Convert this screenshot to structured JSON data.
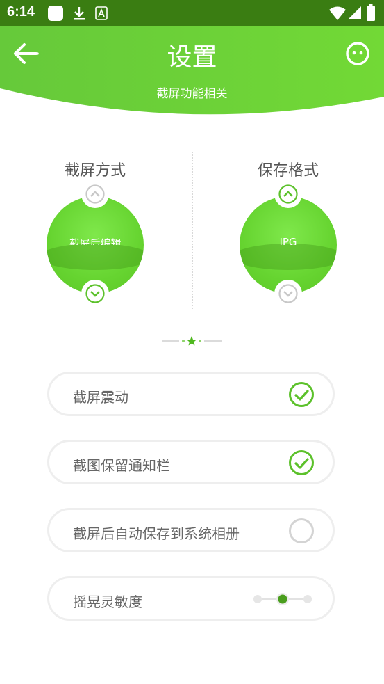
{
  "status_bar": {
    "time": "6:14"
  },
  "header": {
    "title": "设置",
    "subtitle": "截屏功能相关"
  },
  "pickers": [
    {
      "label": "截屏方式",
      "value": "截屏后编辑"
    },
    {
      "label": "保存格式",
      "value": "JPG"
    }
  ],
  "options": [
    {
      "label": "截屏震动",
      "checked": true
    },
    {
      "label": "截图保留通知栏",
      "checked": true
    },
    {
      "label": "截屏后自动保存到系统相册",
      "checked": false
    },
    {
      "label": "摇晃灵敏度",
      "sensitivity_level": 2,
      "sensitivity_max": 3
    }
  ],
  "colors": {
    "status_bar": "#3a7d12",
    "accent": "#6fd23a",
    "check": "#5cc12b",
    "row_border": "#eeeeee"
  }
}
